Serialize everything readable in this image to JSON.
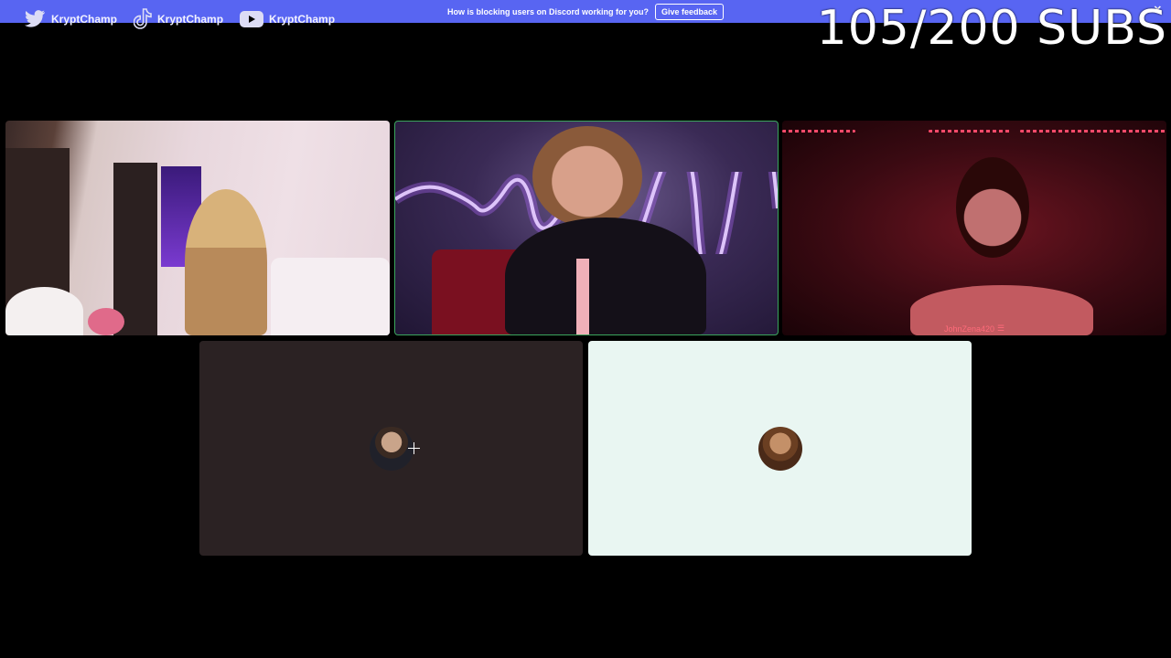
{
  "notice": {
    "text": "How is blocking users on Discord working for you?",
    "button_label": "Give feedback",
    "close_glyph": "✕",
    "bar_color": "#5865f2"
  },
  "socials": [
    {
      "icon": "twitter-icon",
      "handle": "KryptChamp"
    },
    {
      "icon": "tiktok-icon",
      "handle": "KryptChamp"
    },
    {
      "icon": "youtube-icon",
      "handle": "KryptChamp"
    }
  ],
  "subs_counter": "105/200 SUBS",
  "tiles": [
    {
      "participant": "video-1",
      "speaking": false
    },
    {
      "participant": "video-2",
      "speaking": true,
      "border_color": "#3ba55d"
    },
    {
      "participant": "video-3",
      "speaking": false,
      "name": "JohnZena420"
    },
    {
      "participant": "avatar-1",
      "speaking": false
    },
    {
      "participant": "avatar-2",
      "speaking": false
    }
  ]
}
